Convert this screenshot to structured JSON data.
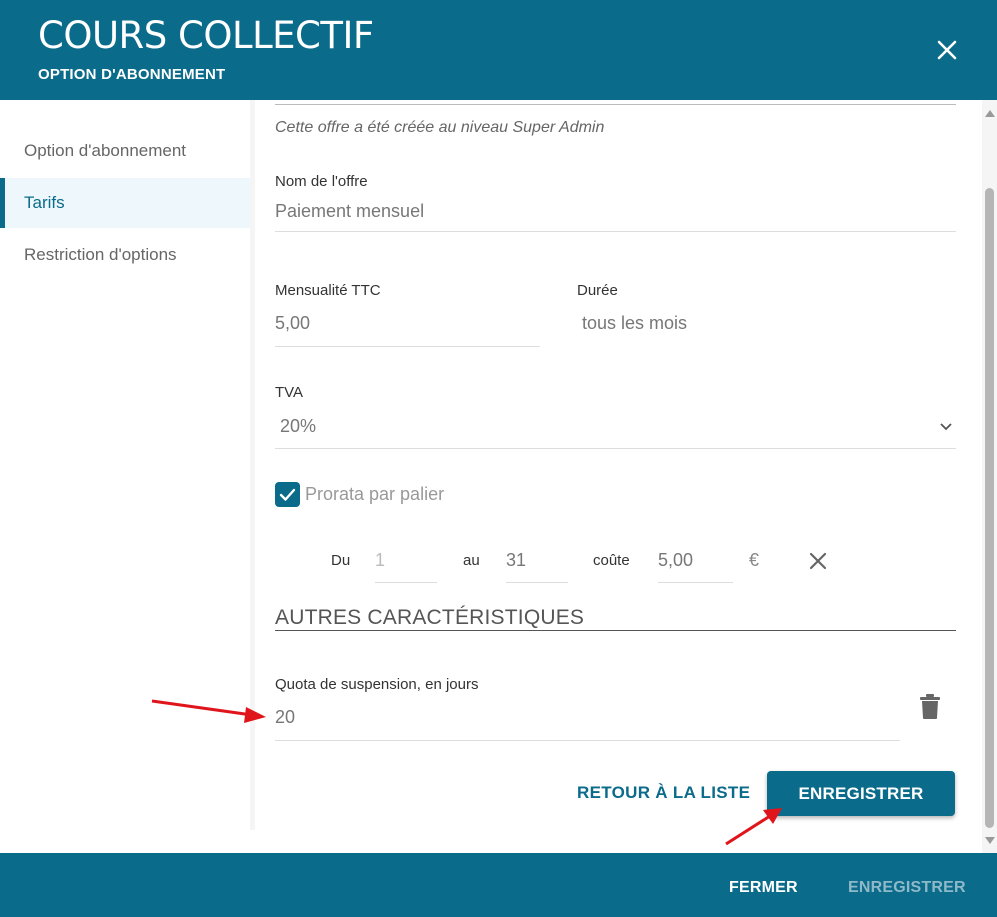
{
  "header": {
    "title": "COURS COLLECTIF",
    "subtitle": "OPTION D'ABONNEMENT",
    "close_icon": "close-icon"
  },
  "sidebar": {
    "items": [
      {
        "label": "Option d'abonnement",
        "active": false
      },
      {
        "label": "Tarifs",
        "active": true
      },
      {
        "label": "Restriction d'options",
        "active": false
      }
    ]
  },
  "form": {
    "note": "Cette offre a été créée au niveau Super Admin",
    "offer_name": {
      "label": "Nom de l'offre",
      "value": "Paiement mensuel"
    },
    "monthly_price": {
      "label": "Mensualité TTC",
      "value": "5,00"
    },
    "duration": {
      "label": "Durée",
      "value": "tous les mois"
    },
    "vat": {
      "label": "TVA",
      "value": "20%"
    },
    "prorata": {
      "label": "Prorata par palier",
      "checked": true
    },
    "tier": {
      "from_label": "Du",
      "from_value": "1",
      "to_label": "au",
      "to_value": "31",
      "cost_label": "coûte",
      "cost_value": "5,00",
      "currency": "€"
    },
    "section_title": "AUTRES CARACTÉRISTIQUES",
    "suspension": {
      "label": "Quota de suspension, en jours",
      "value": "20"
    }
  },
  "actions": {
    "back_label": "RETOUR À LA LISTE",
    "save_label": "ENREGISTRER"
  },
  "footer": {
    "close_label": "FERMER",
    "save_label": "ENREGISTRER"
  },
  "colors": {
    "primary": "#0b6b8a",
    "annotation_arrow": "#e0141b"
  }
}
